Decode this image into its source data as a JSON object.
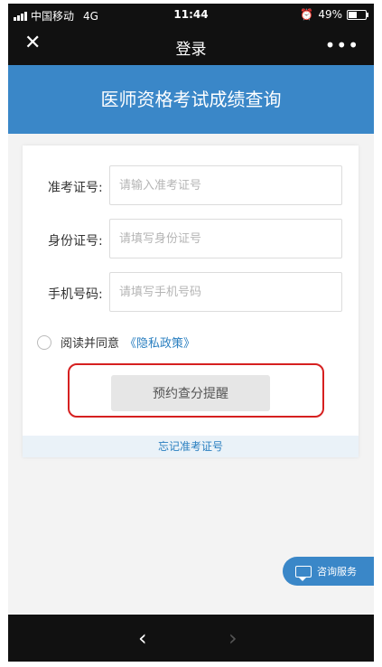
{
  "status_bar": {
    "carrier": "中国移动",
    "network": "4G",
    "time": "11:44",
    "alarm_icon": "alarm-icon",
    "battery_percent": "49%"
  },
  "nav_bar": {
    "close_icon": "close-icon",
    "title": "登录",
    "more_icon": "more-icon"
  },
  "banner": {
    "title": "医师资格考试成绩查询"
  },
  "form": {
    "fields": [
      {
        "label": "准考证号:",
        "placeholder": "请输入准考证号",
        "value": ""
      },
      {
        "label": "身份证号:",
        "placeholder": "请填写身份证号",
        "value": ""
      },
      {
        "label": "手机号码:",
        "placeholder": "请填写手机号码",
        "value": ""
      }
    ],
    "agree_text": "阅读并同意",
    "policy_link": "《隐私政策》",
    "remind_button": "预约查分提醒",
    "forgot_link": "忘记准考证号"
  },
  "consult": {
    "label": "咨询服务",
    "icon": "chat-icon"
  },
  "bottom_bar": {
    "back_icon": "back-arrow-icon",
    "forward_icon": "forward-arrow-icon"
  },
  "colors": {
    "accent": "#3a87c8",
    "highlight": "#d62020",
    "link": "#2a7fc0"
  }
}
